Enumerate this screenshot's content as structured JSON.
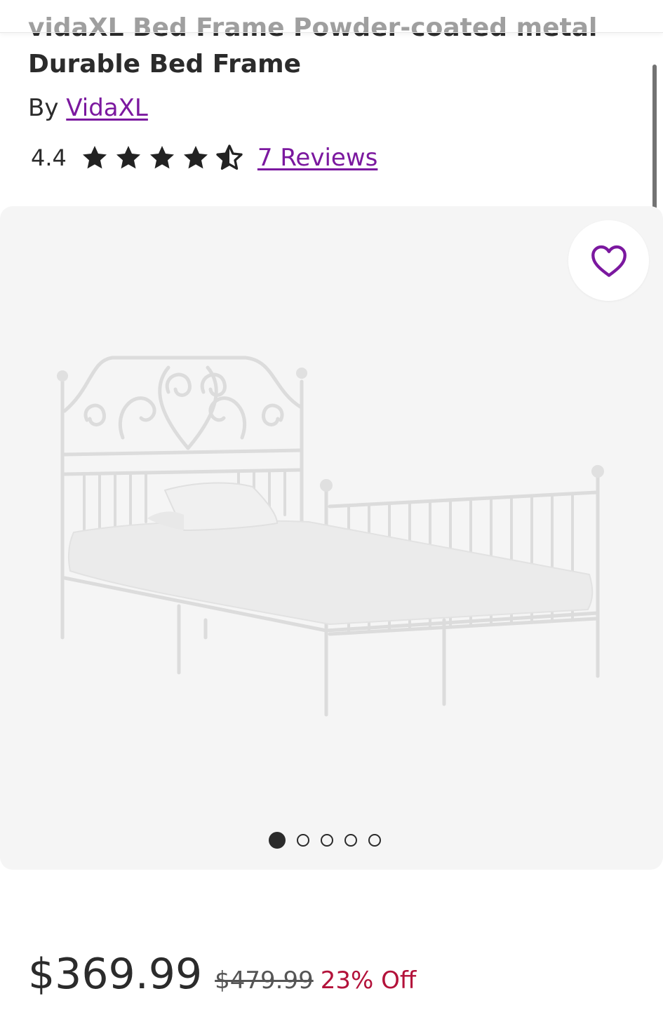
{
  "product": {
    "title": "vidaXL Bed Frame Powder-coated metal Durable Bed Frame",
    "by_prefix": "By",
    "brand": "VidaXL"
  },
  "rating": {
    "value": "4.4",
    "stars_out_of_5": 4.5,
    "reviews_link": "7 Reviews"
  },
  "gallery": {
    "image_alt": "White metal bed frame with ornate scroll headboard",
    "total_images": 5,
    "active_index": 0
  },
  "favorite": {
    "icon": "heart-outline-icon"
  },
  "pricing": {
    "sale_price": "$369.99",
    "original_price": "$479.99",
    "discount": "23% Off"
  },
  "colors": {
    "brand_purple": "#7b189f",
    "discount_red": "#b3123a",
    "text": "#2b2b2b",
    "image_bg": "#f5f5f5"
  }
}
